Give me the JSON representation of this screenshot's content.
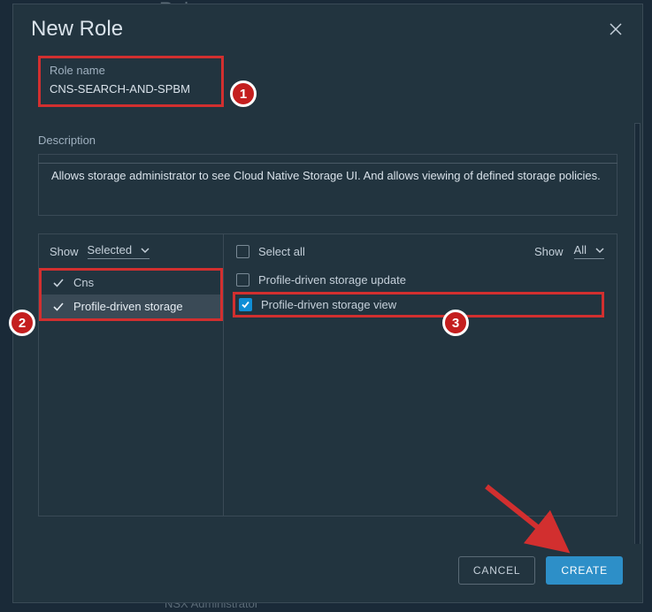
{
  "bg": {
    "top_text": "Roles",
    "bottom_text": "NSX Administrator"
  },
  "modal": {
    "title": "New Role",
    "role_name_label": "Role name",
    "role_name_value": "CNS-SEARCH-AND-SPBM",
    "description_label": "Description",
    "description_value": "Allows storage administrator to see Cloud Native Storage UI. And allows viewing of defined storage policies.",
    "left_filter_label": "Show",
    "left_filter_value": "Selected",
    "categories": [
      {
        "label": "Cns",
        "selected": false,
        "checked": true
      },
      {
        "label": "Profile-driven storage",
        "selected": true,
        "checked": true
      }
    ],
    "select_all_label": "Select all",
    "right_filter_label": "Show",
    "right_filter_value": "All",
    "permissions": [
      {
        "label": "Profile-driven storage update",
        "checked": false,
        "highlighted": false
      },
      {
        "label": "Profile-driven storage view",
        "checked": true,
        "highlighted": true
      }
    ],
    "cancel_label": "CANCEL",
    "create_label": "CREATE"
  },
  "annotations": {
    "b1": "1",
    "b2": "2",
    "b3": "3"
  }
}
